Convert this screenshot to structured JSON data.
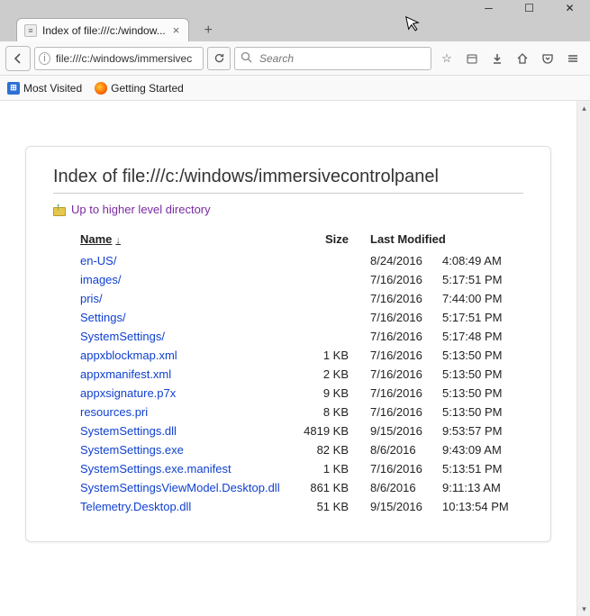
{
  "window": {
    "tab_title": "Index of file:///c:/window..."
  },
  "nav": {
    "url": "file:///c:/windows/immersivec",
    "search_placeholder": "Search"
  },
  "bookmarks": {
    "most_visited": "Most Visited",
    "getting_started": "Getting Started"
  },
  "page": {
    "heading": "Index of file:///c:/windows/immersivecontrolpanel",
    "up_link": "Up to higher level directory",
    "columns": {
      "name": "Name",
      "size": "Size",
      "modified": "Last Modified"
    },
    "rows": [
      {
        "name": "en-US/",
        "size": "",
        "date": "8/24/2016",
        "time": "4:08:49 AM"
      },
      {
        "name": "images/",
        "size": "",
        "date": "7/16/2016",
        "time": "5:17:51 PM"
      },
      {
        "name": "pris/",
        "size": "",
        "date": "7/16/2016",
        "time": "7:44:00 PM"
      },
      {
        "name": "Settings/",
        "size": "",
        "date": "7/16/2016",
        "time": "5:17:51 PM"
      },
      {
        "name": "SystemSettings/",
        "size": "",
        "date": "7/16/2016",
        "time": "5:17:48 PM"
      },
      {
        "name": "appxblockmap.xml",
        "size": "1 KB",
        "date": "7/16/2016",
        "time": "5:13:50 PM"
      },
      {
        "name": "appxmanifest.xml",
        "size": "2 KB",
        "date": "7/16/2016",
        "time": "5:13:50 PM"
      },
      {
        "name": "appxsignature.p7x",
        "size": "9 KB",
        "date": "7/16/2016",
        "time": "5:13:50 PM"
      },
      {
        "name": "resources.pri",
        "size": "8 KB",
        "date": "7/16/2016",
        "time": "5:13:50 PM"
      },
      {
        "name": "SystemSettings.dll",
        "size": "4819 KB",
        "date": "9/15/2016",
        "time": "9:53:57 PM"
      },
      {
        "name": "SystemSettings.exe",
        "size": "82 KB",
        "date": "8/6/2016",
        "time": "9:43:09 AM"
      },
      {
        "name": "SystemSettings.exe.manifest",
        "size": "1 KB",
        "date": "7/16/2016",
        "time": "5:13:51 PM"
      },
      {
        "name": "SystemSettingsViewModel.Desktop.dll",
        "size": "861 KB",
        "date": "8/6/2016",
        "time": "9:11:13 AM"
      },
      {
        "name": "Telemetry.Desktop.dll",
        "size": "51 KB",
        "date": "9/15/2016",
        "time": "10:13:54 PM"
      }
    ]
  }
}
